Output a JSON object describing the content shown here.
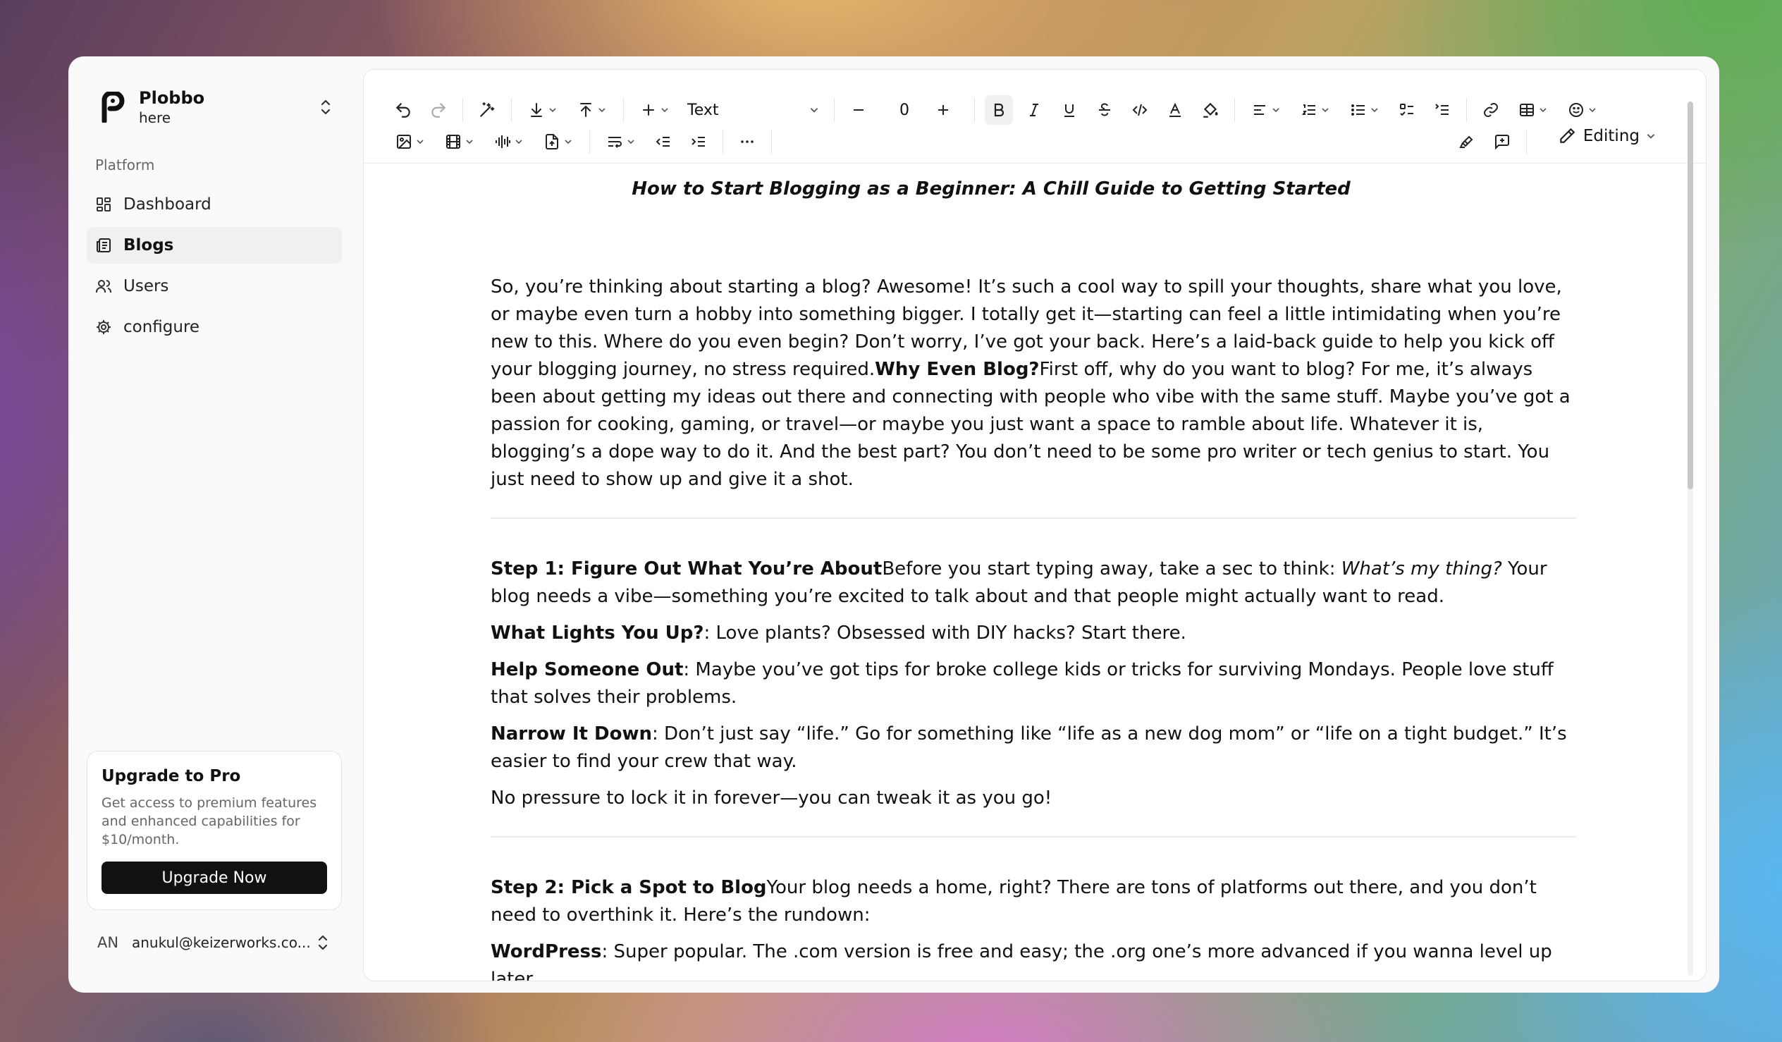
{
  "brand": {
    "name": "Plobbo",
    "sub": "here"
  },
  "sidebar": {
    "section_label": "Platform",
    "items": [
      {
        "label": "Dashboard",
        "icon": "dashboard-icon"
      },
      {
        "label": "Blogs",
        "icon": "blogs-icon",
        "active": true
      },
      {
        "label": "Users",
        "icon": "users-icon"
      },
      {
        "label": "configure",
        "icon": "settings-gear-icon"
      }
    ]
  },
  "upgrade": {
    "title": "Upgrade to Pro",
    "description": "Get access to premium features and enhanced capabilities for $10/month.",
    "button": "Upgrade Now"
  },
  "user": {
    "initials": "AN",
    "email": "anukul@keizerworks.co..."
  },
  "toolbar": {
    "block_type": "Text",
    "font_size": "0",
    "mode": "Editing"
  },
  "document": {
    "title": "How to Start Blogging as a Beginner: A Chill Guide to Getting Started",
    "intro": "So, you’re thinking about starting a blog? Awesome! It’s such a cool way to spill your thoughts, share what you love, or maybe even turn a hobby into something bigger. I totally get it—starting can feel a little intimidating when you’re new to this. Where do you even begin? Don’t worry, I’ve got your back. Here’s a laid-back guide to help you kick off your blogging journey, no stress required.",
    "why_heading": "Why Even Blog?",
    "why_text": "First off, why do you want to blog? For me, it’s always been about getting my ideas out there and connecting with people who vibe with the same stuff. Maybe you’ve got a passion for cooking, gaming, or travel—or maybe you just want a space to ramble about life. Whatever it is, blogging’s a dope way to do it. And the best part? You don’t need to be some pro writer or tech genius to start. You just need to show up and give it a shot.",
    "step1": {
      "heading": "Step 1: Figure Out What You’re About",
      "text_a": "Before you start typing away, take a sec to think: ",
      "text_italic": "What’s my thing?",
      "text_b": " Your blog needs a vibe—something you’re excited to talk about and that people might actually want to read.",
      "points": [
        {
          "label": "What Lights You Up?",
          "text": ": Love plants? Obsessed with DIY hacks? Start there."
        },
        {
          "label": "Help Someone Out",
          "text": ": Maybe you’ve got tips for broke college kids or tricks for surviving Mondays. People love stuff that solves their problems."
        },
        {
          "label": "Narrow It Down",
          "text": ": Don’t just say “life.” Go for something like “life as a new dog mom” or “life on a tight budget.” It’s easier to find your crew that way."
        }
      ],
      "closing": "No pressure to lock it in forever—you can tweak it as you go!"
    },
    "step2": {
      "heading": "Step 2: Pick a Spot to Blog",
      "text": "Your blog needs a home, right? There are tons of platforms out there, and you don’t need to overthink it. Here’s the rundown:",
      "points": [
        {
          "label": "WordPress",
          "text": ": Super popular. The .com version is free and easy; the .org one’s more advanced if you wanna level up later."
        }
      ]
    }
  }
}
